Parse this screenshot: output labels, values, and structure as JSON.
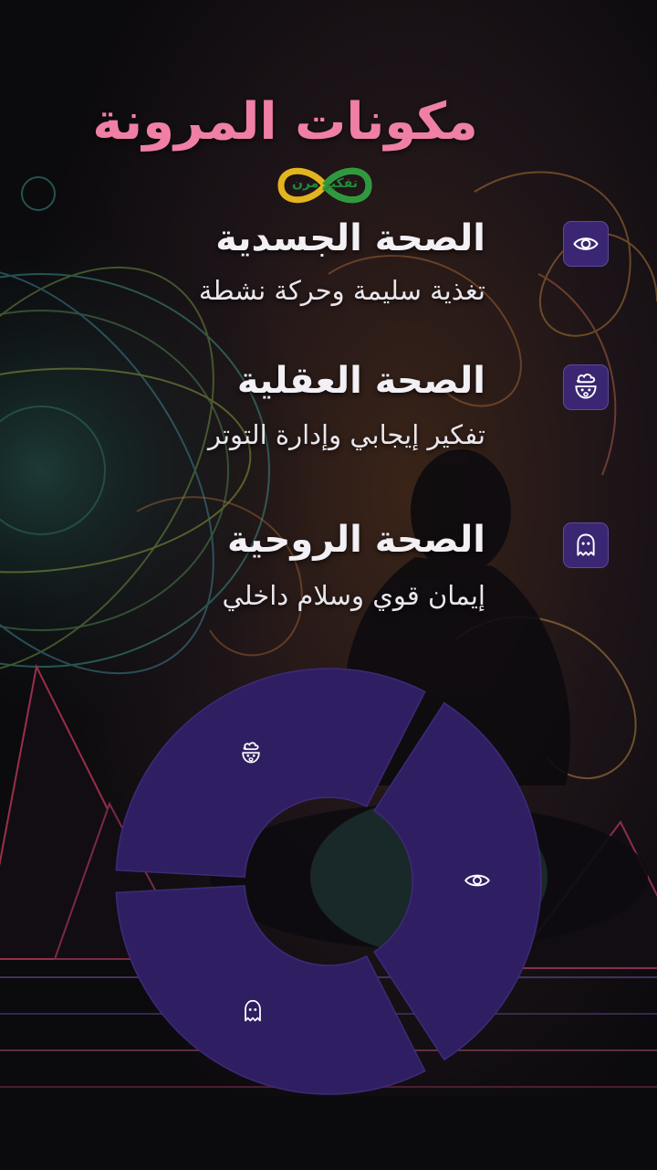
{
  "title": "مكونات المرونة",
  "logo": {
    "text": "تفكير مرن",
    "icon": "infinity-logo"
  },
  "colors": {
    "title": "#f07fa6",
    "accent_purple": "#2f1f62",
    "icon_box": "#3a2672",
    "text": "#f2f0f4"
  },
  "items": [
    {
      "heading": "الصحة الجسدية",
      "description": "تغذية سليمة وحركة نشطة",
      "icon": "eye-icon"
    },
    {
      "heading": "الصحة العقلية",
      "description": "تفكير إيجابي وإدارة التوتر",
      "icon": "mind-blown-icon"
    },
    {
      "heading": "الصحة الروحية",
      "description": "إيمان قوي وسلام داخلي",
      "icon": "ghost-icon"
    }
  ],
  "donut": {
    "segments": [
      {
        "icon": "mind-blown-icon"
      },
      {
        "icon": "eye-icon"
      },
      {
        "icon": "ghost-icon"
      }
    ]
  }
}
